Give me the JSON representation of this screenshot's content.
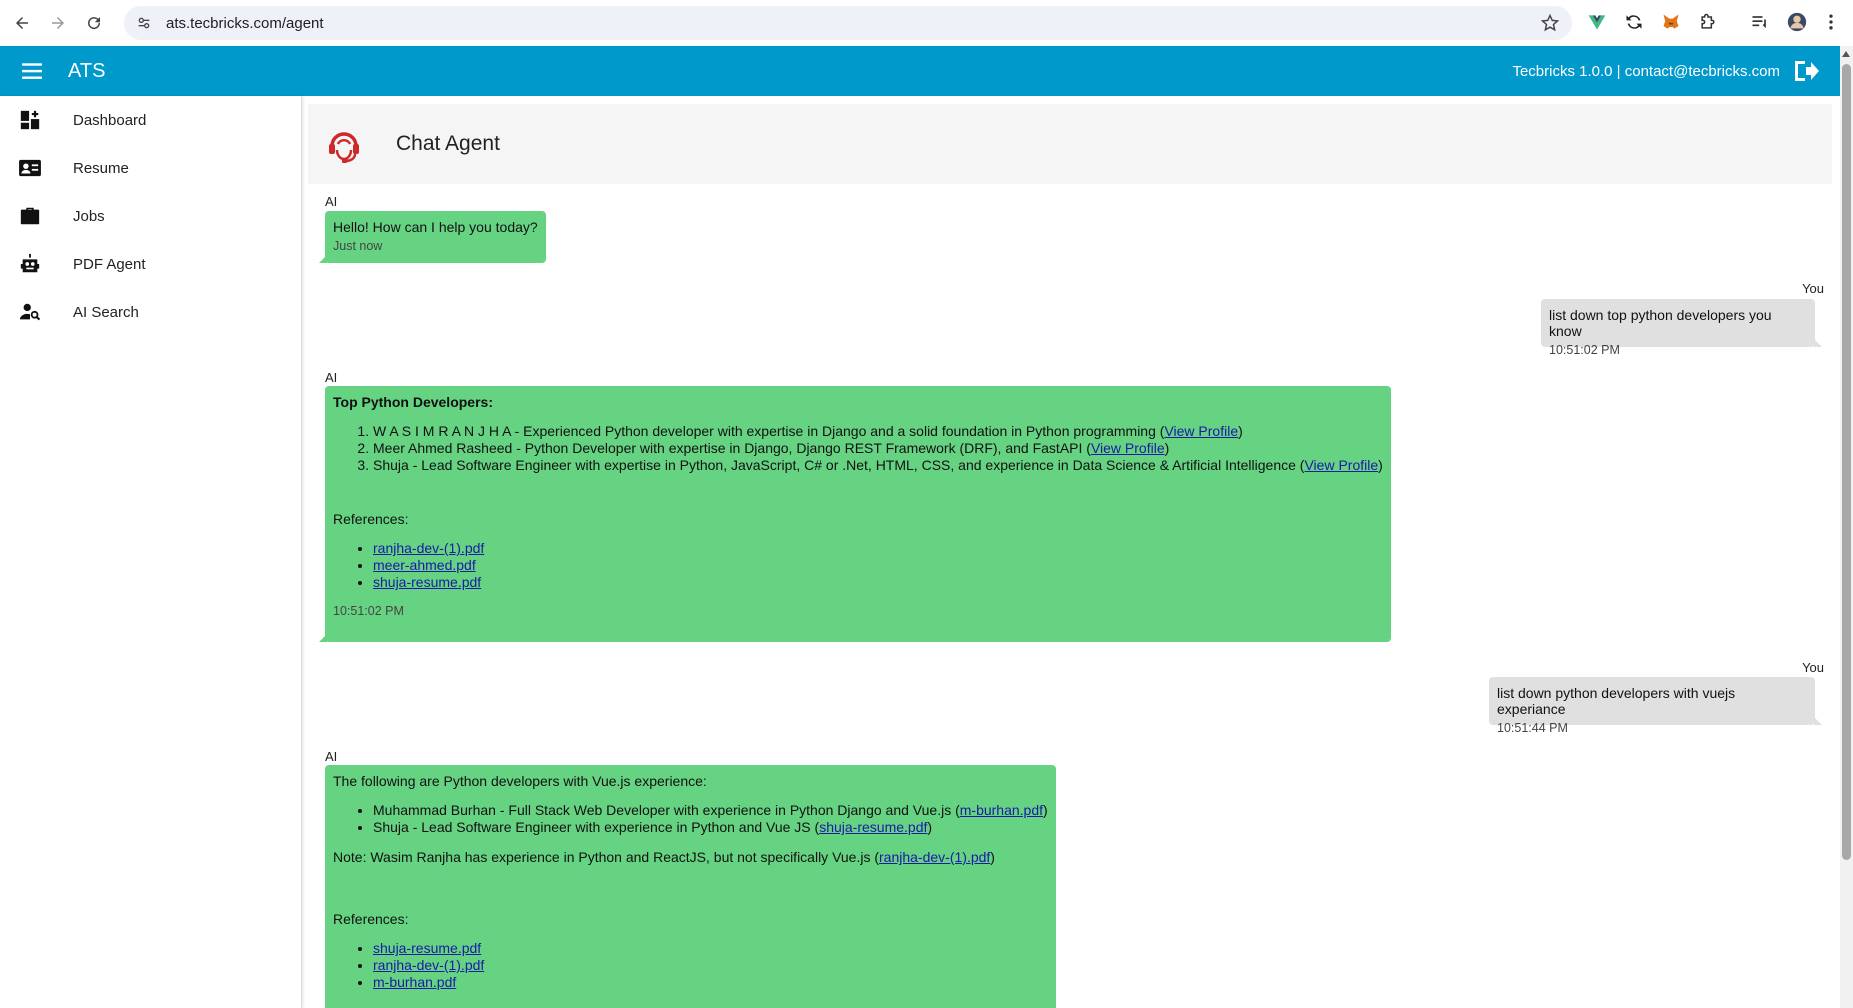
{
  "browser": {
    "url": "ats.tecbricks.com/agent"
  },
  "appbar": {
    "title": "ATS",
    "info": "Tecbricks 1.0.0 | contact@tecbricks.com"
  },
  "sidebar": {
    "items": [
      {
        "label": "Dashboard",
        "icon": "dashboard-icon"
      },
      {
        "label": "Resume",
        "icon": "contact-card-icon"
      },
      {
        "label": "Jobs",
        "icon": "briefcase-icon"
      },
      {
        "label": "PDF Agent",
        "icon": "robot-icon"
      },
      {
        "label": "AI Search",
        "icon": "person-search-icon"
      }
    ]
  },
  "agent": {
    "title": "Chat Agent",
    "icon": "headset-agent-icon",
    "accent": "#cc2a2a"
  },
  "colors": {
    "appbar": "#0099cc",
    "ai_bubble": "#66d383",
    "user_bubble": "#e0e0e0",
    "link": "#1a1aa6"
  },
  "chat": {
    "m1": {
      "sender": "AI",
      "text": "Hello! How can I help you today?",
      "time": "Just now"
    },
    "m2": {
      "sender": "You",
      "text": "list down top python developers you know",
      "time": "10:51:02 PM"
    },
    "m3": {
      "sender": "AI",
      "heading": "Top Python Developers:",
      "items": [
        {
          "text": "W A S I M R A N J H A - Experienced Python developer with expertise in Django and a solid foundation in Python programming (",
          "link": "View Profile",
          "after": ")"
        },
        {
          "text": "Meer Ahmed Rasheed - Python Developer with expertise in Django, Django REST Framework (DRF), and FastAPI (",
          "link": "View Profile",
          "after": ")"
        },
        {
          "text": "Shuja - Lead Software Engineer with expertise in Python, JavaScript, C# or .Net, HTML, CSS, and experience in Data Science & Artificial Intelligence (",
          "link": "View Profile",
          "after": ")"
        }
      ],
      "references_label": "References:",
      "references": [
        "ranjha-dev-(1).pdf",
        "meer-ahmed.pdf",
        "shuja-resume.pdf"
      ],
      "time": "10:51:02 PM"
    },
    "m4": {
      "sender": "You",
      "text": "list down python developers with vuejs experiance",
      "time": "10:51:44 PM"
    },
    "m5": {
      "sender": "AI",
      "intro": "The following are Python developers with Vue.js experience:",
      "items": [
        {
          "text": "Muhammad Burhan - Full Stack Web Developer with experience in Python Django and Vue.js (",
          "link": "m-burhan.pdf",
          "after": ")"
        },
        {
          "text": "Shuja - Lead Software Engineer with experience in Python and Vue JS (",
          "link": "shuja-resume.pdf",
          "after": ")"
        }
      ],
      "note": {
        "text": "Note: Wasim Ranjha has experience in Python and ReactJS, but not specifically Vue.js (",
        "link": "ranjha-dev-(1).pdf",
        "after": ")"
      },
      "references_label": "References:",
      "references": [
        "shuja-resume.pdf",
        "ranjha-dev-(1).pdf",
        "m-burhan.pdf"
      ]
    }
  }
}
